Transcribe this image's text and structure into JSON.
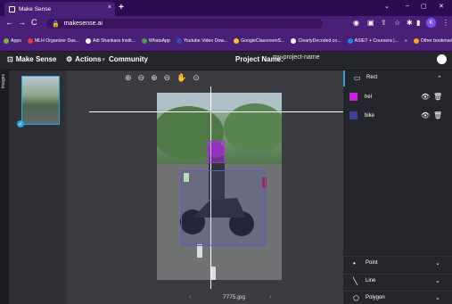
{
  "browser": {
    "tab_title": "Make Sense",
    "tab_close": "×",
    "new_tab": "+",
    "url": "makesense.ai",
    "window_controls": {
      "minimize": "–",
      "maximize": "▢",
      "close": "✕",
      "tabs_menu": "⌄"
    },
    "profile_initial": "K",
    "bookmarks": [
      {
        "label": "Apps",
        "color": "#7cb342"
      },
      {
        "label": "MLH Organizer Das...",
        "color": "#e53935"
      },
      {
        "label": "Adi Shankara Instit...",
        "color": "#ffffff"
      },
      {
        "label": "WhatsApp",
        "color": "#43a047"
      },
      {
        "label": "Youtube Video Dow...",
        "color": "#3949ab"
      },
      {
        "label": "GoogleClassroomS...",
        "color": "#fbc02d"
      },
      {
        "label": "ClearlyDecoded.co...",
        "color": "#ffffff"
      },
      {
        "label": "ASIET + Coursera |...",
        "color": "#1e88e5"
      },
      {
        "label": "»",
        "color": ""
      },
      {
        "label": "Other bookmarks",
        "color": "#f9a825"
      }
    ]
  },
  "app": {
    "brand": "Make Sense",
    "nav_actions": "Actions",
    "nav_community": "Community",
    "project_label": "Project Name:",
    "project_name": "my-project-name",
    "sidebar_tab": "Images",
    "filename": "7775.jpg",
    "prev_arrow": "‹",
    "next_arrow": "›"
  },
  "right_panel": {
    "rect_title": "Rect",
    "labels": [
      {
        "name": "hel",
        "color": "#c51fe8"
      },
      {
        "name": "bike",
        "color": "#3d3d9a"
      }
    ],
    "tools": [
      {
        "name": "Point",
        "icon": "point-icon"
      },
      {
        "name": "Line",
        "icon": "line-icon"
      },
      {
        "name": "Polygon",
        "icon": "polygon-icon"
      }
    ]
  },
  "colors": {
    "accent": "#2aa5e0",
    "browser_purple": "#4a1f78",
    "app_bg": "#24262c"
  }
}
